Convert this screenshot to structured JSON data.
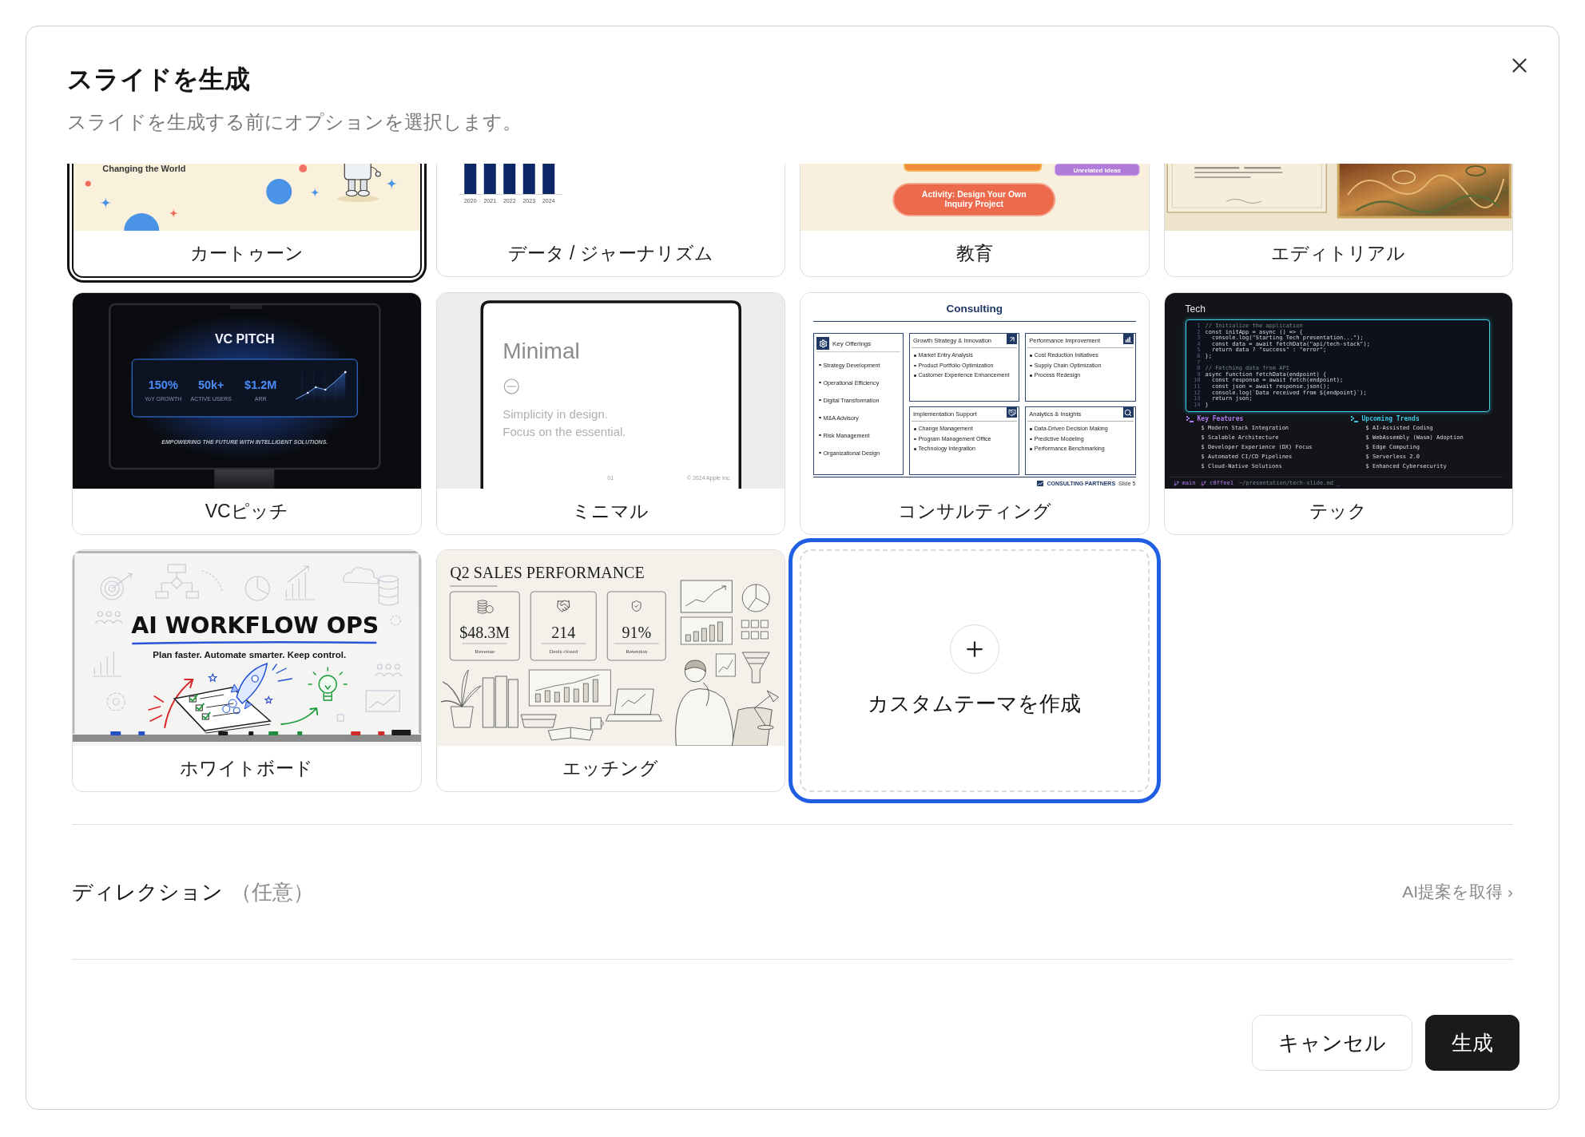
{
  "dialog": {
    "title": "スライドを生成",
    "subtitle": "スライドを生成する前にオプションを選択します。"
  },
  "themes": [
    {
      "kind": "cartoon",
      "label": "カートゥーン",
      "selected": true,
      "cut_off": true,
      "slide": {
        "caption": "Changing the World"
      }
    },
    {
      "kind": "data",
      "label": "データ / ジャーナリズム",
      "selected": false,
      "cut_off": true,
      "slide": {
        "years": [
          "2020",
          "2021",
          "2022",
          "2023",
          "2024"
        ]
      }
    },
    {
      "kind": "education",
      "label": "教育",
      "selected": false,
      "cut_off": true,
      "slide": {
        "tag": "Unrelated Ideas",
        "activity_lines": [
          "Activity: Design Your Own",
          "Inquiry Project"
        ]
      }
    },
    {
      "kind": "editorial",
      "label": "エディトリアル",
      "selected": false,
      "cut_off": true
    },
    {
      "kind": "vc_pitch",
      "label": "VCピッチ",
      "selected": false,
      "cut_off": false,
      "slide": {
        "title": "VC PITCH",
        "stats": [
          {
            "value": "150%",
            "caption": "YoY GROWTH"
          },
          {
            "value": "50k+",
            "caption": "ACTIVE USERS"
          },
          {
            "value": "$1.2M",
            "caption": "ARR"
          }
        ],
        "tagline": "EMPOWERING THE FUTURE WITH INTELLIGENT SOLUTIONS."
      }
    },
    {
      "kind": "minimal",
      "label": "ミニマル",
      "selected": false,
      "cut_off": false,
      "slide": {
        "title": "Minimal",
        "lines": [
          "Simplicity in design.",
          "Focus on the essential."
        ],
        "page": "01",
        "footer": "© 2024 Apple Inc."
      }
    },
    {
      "kind": "consulting",
      "label": "コンサルティング",
      "selected": false,
      "cut_off": false,
      "slide": {
        "title": "Consulting",
        "sidebar": {
          "heading": "Key Offerings",
          "items": [
            "Strategy Development",
            "Operational Efficiency",
            "Digital Transformation",
            "M&A Advisory",
            "Risk Management",
            "Organizational Design"
          ]
        },
        "panels": [
          {
            "heading": "Growth Strategy & Innovation",
            "items": [
              "Market Entry Analysis",
              "Product Portfolio Optimization",
              "Customer Experience Enhancement"
            ]
          },
          {
            "heading": "Performance Improvement",
            "items": [
              "Cost Reduction Initiatives",
              "Supply Chain Optimization",
              "Process Redesign"
            ]
          },
          {
            "heading": "Implementation Support",
            "items": [
              "Change Management",
              "Program Management Office",
              "Technology Integration"
            ]
          },
          {
            "heading": "Analytics & Insights",
            "items": [
              "Data-Driven Decision Making",
              "Predictive Modeling",
              "Performance Benchmarking"
            ]
          }
        ],
        "logo": "CONSULTING PARTNERS",
        "page": "Slide 5"
      }
    },
    {
      "kind": "tech",
      "label": "テック",
      "selected": false,
      "cut_off": false,
      "slide": {
        "title": "Tech",
        "code": [
          {
            "number": "1",
            "kind": "comment",
            "text": "// Initialize the application"
          },
          {
            "number": "2",
            "kind": "code",
            "text": "const initApp = async () => {"
          },
          {
            "number": "3",
            "kind": "code",
            "text": "  console.log(\"Starting Tech presentation...\");"
          },
          {
            "number": "4",
            "kind": "code",
            "text": "  const data = await fetchData(\"api/tech-stack\");"
          },
          {
            "number": "5",
            "kind": "code",
            "text": "  return data ? \"success\" : \"error\";"
          },
          {
            "number": "6",
            "kind": "code",
            "text": "};"
          },
          {
            "number": "7"
          },
          {
            "number": "8",
            "kind": "comment",
            "text": "// Fetching data from API"
          },
          {
            "number": "9",
            "kind": "code",
            "text": "async function fetchData(endpoint) {"
          },
          {
            "number": "10",
            "kind": "code",
            "text": "  const response = await fetch(endpoint);"
          },
          {
            "number": "11",
            "kind": "code",
            "text": "  const json = await response.json();"
          },
          {
            "number": "12",
            "kind": "code",
            "text": "  console.log(`Data received from ${endpoint}`);"
          },
          {
            "number": "13",
            "kind": "code",
            "text": "  return json;"
          },
          {
            "number": "14",
            "kind": "code",
            "text": "}"
          }
        ],
        "columns": [
          {
            "heading": "Key Features",
            "color": "#b27cf2",
            "items": [
              "$ Modern Stack Integration",
              "$ Scalable Architecture",
              "$ Developer Experience (DX) Focus",
              "$ Automated CI/CD Pipelines",
              "$ Cloud-Native Solutions"
            ]
          },
          {
            "heading": "Upcoming Trends",
            "color": "#3ec7e4",
            "items": [
              "$ AI-Assisted Coding",
              "$ WebAssembly (Wasm) Adoption",
              "$ Edge Computing",
              "$ Serverless 2.0",
              "$ Enhanced Cybersecurity"
            ]
          }
        ],
        "branch": "main",
        "commit": "c0ffee1",
        "path": "~/presentation/tech-slide.md _"
      }
    },
    {
      "kind": "whiteboard",
      "label": "ホワイトボード",
      "selected": false,
      "cut_off": false,
      "slide": {
        "title": "AI WORKFLOW OPS",
        "subtitle": "Plan faster. Automate smarter. Keep control."
      }
    },
    {
      "kind": "etching",
      "label": "エッチング",
      "selected": false,
      "cut_off": false,
      "slide": {
        "title": "Q2 SALES PERFORMANCE",
        "stats": [
          {
            "value": "$48.3M",
            "caption": "Revenue"
          },
          {
            "value": "214",
            "caption": "Deals closed"
          },
          {
            "value": "91%",
            "caption": "Retention"
          }
        ]
      }
    }
  ],
  "custom_theme": {
    "label": "カスタムテーマを作成",
    "focused": true
  },
  "direction": {
    "label": "ディレクション",
    "hint": "（任意）",
    "link": "AI提案を取得 ›"
  },
  "buttons": [
    {
      "kind": "secondary",
      "label": "キャンセル"
    },
    {
      "kind": "primary",
      "label": "生成"
    }
  ]
}
